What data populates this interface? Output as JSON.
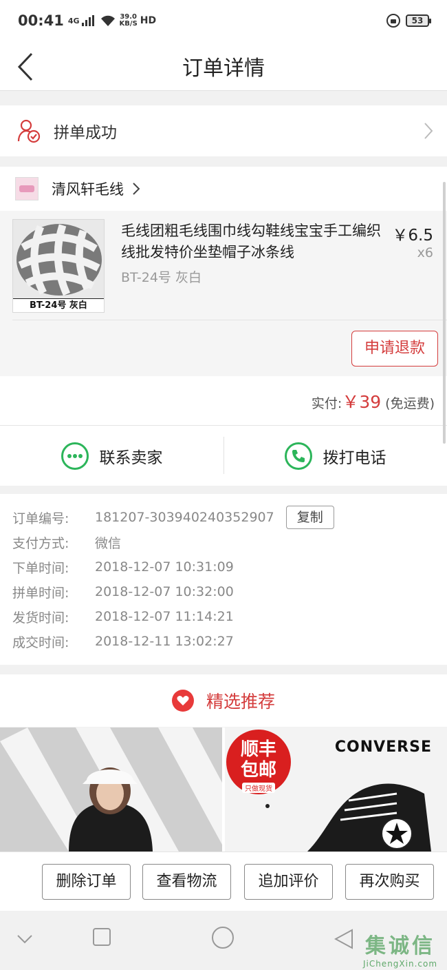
{
  "status_bar": {
    "time": "00:41",
    "net": "4G",
    "speed_top": "39.0",
    "speed_unit": "KB/S",
    "hd": "HD",
    "battery": "53"
  },
  "nav": {
    "title": "订单详情"
  },
  "order_status": {
    "label": "拼单成功"
  },
  "shop": {
    "name": "清风轩毛线"
  },
  "product": {
    "title": "毛线团粗毛线围巾线勾鞋线宝宝手工编织线批发特价坐垫帽子冰条线",
    "spec": "BT-24号 灰白",
    "image_caption": "BT-24号 灰白",
    "price": "￥6.5",
    "quantity": "x6",
    "refund_button": "申请退款"
  },
  "payment": {
    "label": "实付:",
    "amount": "￥39",
    "note": "(免运费)"
  },
  "contact": {
    "seller": "联系卖家",
    "phone": "拨打电话"
  },
  "order_info": {
    "rows": [
      {
        "key": "订单编号:",
        "value": "181207-303940240352907"
      },
      {
        "key": "支付方式:",
        "value": "微信"
      },
      {
        "key": "下单时间:",
        "value": "2018-12-07 10:31:09"
      },
      {
        "key": "拼单时间:",
        "value": "2018-12-07 10:32:00"
      },
      {
        "key": "发货时间:",
        "value": "2018-12-07 11:14:21"
      },
      {
        "key": "成交时间:",
        "value": "2018-12-11 13:02:27"
      }
    ],
    "copy_button": "复制"
  },
  "recommend": {
    "title": "精选推荐",
    "tile2_brand": "CONVERSE",
    "tile2_badge_line1": "顺丰",
    "tile2_badge_line2": "包邮",
    "tile2_badge_line3": "只做现货"
  },
  "actions": {
    "delete": "删除订单",
    "logistics": "查看物流",
    "review": "追加评价",
    "rebuy": "再次购买"
  },
  "watermark": {
    "line1": "集诚信",
    "line2": "JiChengXin.com"
  },
  "colors": {
    "accent": "#d43c3c",
    "green": "#2cb55a"
  }
}
